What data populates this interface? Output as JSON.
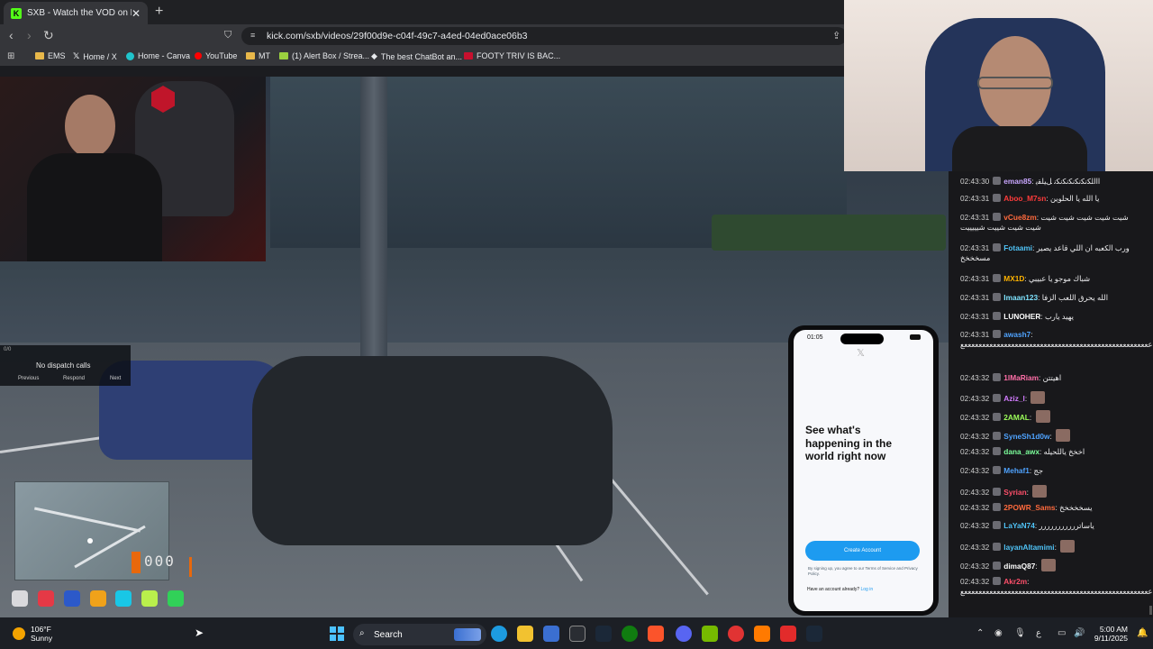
{
  "browser": {
    "tab_title": "SXB - Watch the VOD on Kick",
    "tab_icon": "K",
    "url": "kick.com/sxb/videos/29f00d9e-c04f-49c7-a4ed-04ed0ace06b3",
    "bookmarks": [
      {
        "label": "EMS",
        "color": "#e8b84a"
      },
      {
        "label": "Home / X",
        "color": "#ffffff"
      },
      {
        "label": "Home - Canva",
        "color": "#20c4cb"
      },
      {
        "label": "YouTube",
        "color": "#ff0000"
      },
      {
        "label": "MT",
        "color": "#e8b84a"
      },
      {
        "label": "(1) Alert Box / Strea...",
        "color": "#9bd13f"
      },
      {
        "label": "The best ChatBot an...",
        "color": "#ffffff"
      },
      {
        "label": "FOOTY TRIV IS BAC...",
        "color": "#c8102e"
      }
    ]
  },
  "game": {
    "dispatch_text": "No dispatch calls",
    "dispatch_counter": "0/0",
    "dispatch_buttons": [
      "Previous",
      "Respond",
      "Next"
    ],
    "speed": "000",
    "phone": {
      "time": "01:05",
      "headline": "See what's happening in the world right now",
      "create_button": "Create Account",
      "terms": "By signing up, you agree to our Terms of Service and Privacy Policy.",
      "already": "Have an account already?",
      "login": "Log in"
    }
  },
  "chat": [
    {
      "time": "02:43:30",
      "user": "eman85",
      "color": "#c9a6ff",
      "msg": "ﺍﺍﺍﻠﻜﻧﻜﻧﻜﻧﻜﻧﻜﻧﻜﻧ ﻞﻴﻠﻘﻳ"
    },
    {
      "time": "02:43:31",
      "user": "Aboo_M7sn",
      "color": "#ff3b3b",
      "msg": "يا الله يا الحلوين"
    },
    {
      "time": "02:43:31",
      "user": "vCue8zm",
      "color": "#ff6a3d",
      "msg": "شيت شيت شيت شيت شيت شيت شيت شييت شيييييت"
    },
    {
      "time": "02:43:31",
      "user": "Fotaami",
      "color": "#4fc3f7",
      "msg": "ورب الكعبه ان اللي قاعد يصير مسخخخخ"
    },
    {
      "time": "02:43:31",
      "user": "MX1D",
      "color": "#ffb300",
      "msg": "شباك موجو يا عبيبي"
    },
    {
      "time": "02:43:31",
      "user": "Imaan123",
      "color": "#7ee3ff",
      "msg": "الله يحرق اللعب الزفا"
    },
    {
      "time": "02:43:31",
      "user": "LUNOHER",
      "color": "#ffffff",
      "msg": "يهيد يارب"
    },
    {
      "time": "02:43:31",
      "user": "awash7",
      "color": "#4fa3ff",
      "msg": "ععععععععععععععععععععععععععععععععععععععععععععععععععععع"
    },
    {
      "time": "02:43:32",
      "user": "1lMaRiam",
      "color": "#ff6fa8",
      "msg": "اهيتتن"
    },
    {
      "time": "02:43:32",
      "user": "Aziz_l",
      "color": "#d27bff",
      "msg": ""
    },
    {
      "time": "02:43:32",
      "user": "2AMAL",
      "color": "#9dff5a",
      "msg": ""
    },
    {
      "time": "02:43:32",
      "user": "SyneSh1d0w",
      "color": "#4fa3ff",
      "msg": ""
    },
    {
      "time": "02:43:32",
      "user": "dana_awx",
      "color": "#7cff9b",
      "msg": "اخخخ ياللحيله"
    },
    {
      "time": "02:43:32",
      "user": "Mehaf1",
      "color": "#4fa3ff",
      "msg": "جج"
    },
    {
      "time": "02:43:32",
      "user": "Syrian",
      "color": "#ff4f6a",
      "msg": ""
    },
    {
      "time": "02:43:32",
      "user": "2POWR_Sams",
      "color": "#ff6a3d",
      "msg": "يسخخخخخ"
    },
    {
      "time": "02:43:32",
      "user": "LaYaN74",
      "color": "#4fc3f7",
      "msg": "ياساتررررررررررر"
    },
    {
      "time": "02:43:32",
      "user": "layanAltamimi",
      "color": "#4fc3f7",
      "msg": ""
    },
    {
      "time": "02:43:32",
      "user": "dimaQ87",
      "color": "#ffffff",
      "msg": ""
    },
    {
      "time": "02:43:32",
      "user": "Akr2m",
      "color": "#ff4f6a",
      "msg": "ععععععععععععععععععععععععععععععععععععععععععععععععععععع"
    }
  ],
  "taskbar": {
    "temp": "106°F",
    "condition": "Sunny",
    "search": "Search",
    "time": "5:00 AM",
    "date": "9/11/2025"
  }
}
